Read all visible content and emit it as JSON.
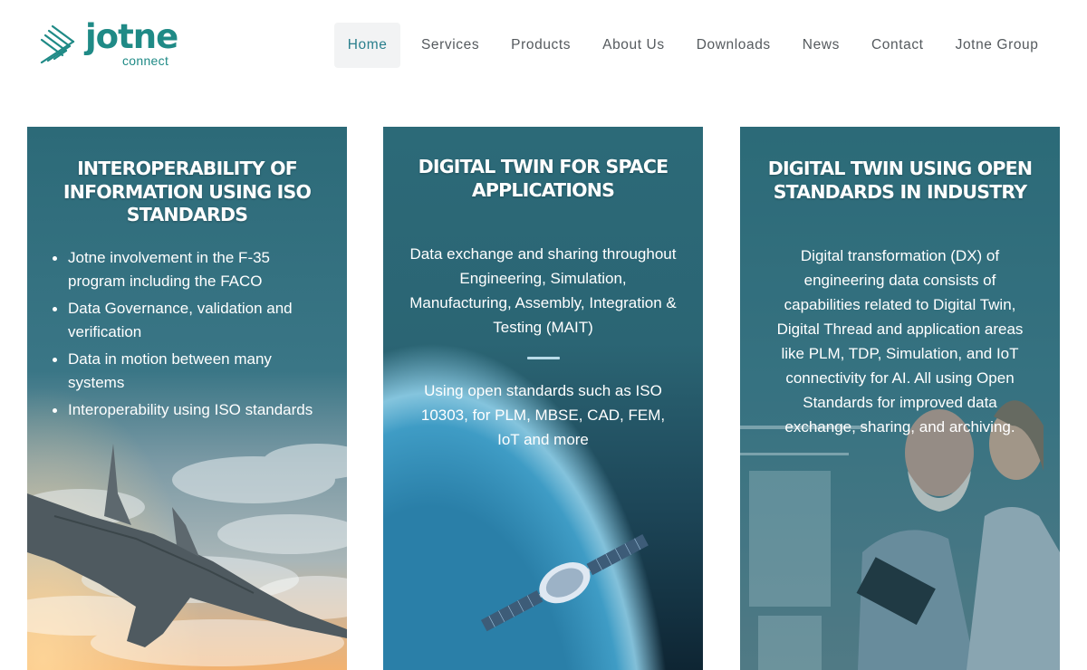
{
  "logo": {
    "wordmark": "jotne",
    "tagline": "connect",
    "icon": "chevron-stripes-logo-icon",
    "color": "#1f8a86"
  },
  "nav": {
    "items": [
      {
        "label": "Home",
        "active": true
      },
      {
        "label": "Services"
      },
      {
        "label": "Products"
      },
      {
        "label": "About Us"
      },
      {
        "label": "Downloads"
      },
      {
        "label": "News"
      },
      {
        "label": "Contact"
      },
      {
        "label": "Jotne Group"
      }
    ],
    "active_color": "#2b7f8d"
  },
  "cards": [
    {
      "title": "INTEROPERABILITY OF INFORMATION USING ISO STANDARDS",
      "bullets": [
        "Jotne involvement in the F-35 program including the FACO",
        "Data Governance, validation and verification",
        "Data in motion between many systems",
        "Interoperability using ISO standards"
      ],
      "image": "fighter-jet-above-clouds"
    },
    {
      "title": "DIGITAL TWIN FOR SPACE APPLICATIONS",
      "text1": "Data exchange and sharing throughout Engineering, Simulation, Manufacturing, Assembly, Integration & Testing (MAIT)",
      "text2": "Using open standards such as ISO 10303, for PLM, MBSE, CAD, FEM, IoT and more",
      "image": "satellite-over-earth"
    },
    {
      "title": "DIGITAL TWIN USING OPEN STANDARDS IN INDUSTRY",
      "text1": "Digital transformation (DX) of engineering data consists of capabilities related to Digital Twin, Digital Thread and application areas like PLM, TDP, Simulation, and IoT connectivity for AI. All using Open Standards for improved data exchange, sharing, and archiving.",
      "image": "engineers-with-tablet-in-factory"
    }
  ],
  "colors": {
    "card_teal": "#2d6b79",
    "brand": "#1f8a86"
  }
}
